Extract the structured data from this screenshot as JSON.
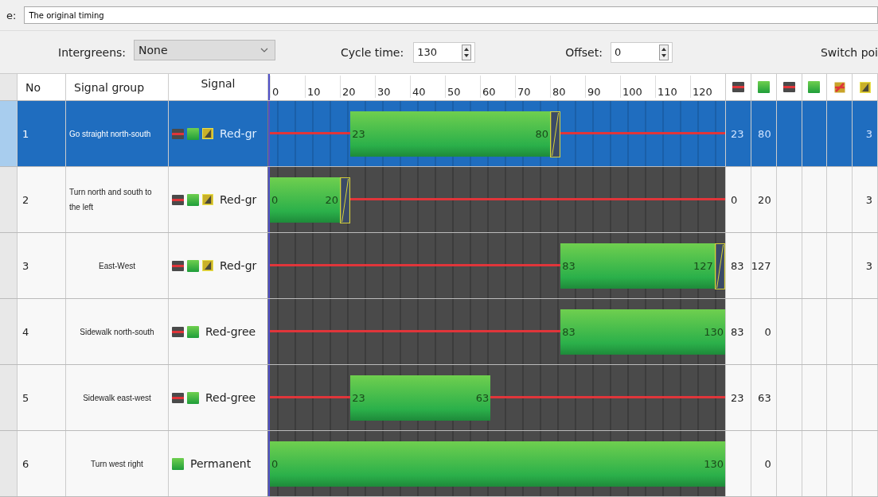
{
  "name_field": {
    "label": "e:",
    "value": "The original timing"
  },
  "toolbar": {
    "intergreens_label": "Intergreens:",
    "intergreens_value": "None",
    "cycle_label": "Cycle time:",
    "cycle_value": "130",
    "offset_label": "Offset:",
    "offset_value": "0",
    "switch_label": "Switch poi"
  },
  "table": {
    "columns": {
      "no": "No",
      "group": "Signal group",
      "signal": "Signal"
    },
    "ticks": [
      "0",
      "10",
      "20",
      "30",
      "40",
      "50",
      "60",
      "70",
      "80",
      "90",
      "100",
      "110",
      "120"
    ],
    "state_columns": [
      {
        "kind": "stop"
      },
      {
        "kind": "go"
      },
      {
        "kind": "stop"
      },
      {
        "kind": "go"
      },
      {
        "kind": "crossed"
      },
      {
        "kind": "amber"
      }
    ],
    "rows": [
      {
        "no": "1",
        "group": "Go straight north-south",
        "signals": [
          {
            "kind": "stop"
          },
          {
            "kind": "go"
          },
          {
            "kind": "amber"
          }
        ],
        "signal_text": "Red-gr",
        "selected": true,
        "kind": "red-green",
        "green_start": "23",
        "green_end": "80",
        "col_1": "23",
        "col_2": "80",
        "col_6": "3"
      },
      {
        "no": "2",
        "group": "Turn north and south to the left",
        "signals": [
          {
            "kind": "stop"
          },
          {
            "kind": "go"
          },
          {
            "kind": "amber"
          }
        ],
        "signal_text": "Red-gr",
        "selected": false,
        "kind": "red-green",
        "green_start": "0",
        "green_end": "20",
        "col_1": "0",
        "col_2": "20",
        "col_6": "3"
      },
      {
        "no": "3",
        "group": "East-West",
        "signals": [
          {
            "kind": "stop"
          },
          {
            "kind": "go"
          },
          {
            "kind": "amber"
          }
        ],
        "signal_text": "Red-gr",
        "selected": false,
        "kind": "red-green",
        "green_start": "83",
        "green_end": "127",
        "col_1": "83",
        "col_2": "127",
        "col_6": "3"
      },
      {
        "no": "4",
        "group": "Sidewalk north-south",
        "signals": [
          {
            "kind": "stop"
          },
          {
            "kind": "go"
          }
        ],
        "signal_text": "Red-gree",
        "selected": false,
        "kind": "red-green",
        "green_start": "83",
        "green_end": "130",
        "col_1": "83",
        "col_2": "0"
      },
      {
        "no": "5",
        "group": "Sidewalk east-west",
        "signals": [
          {
            "kind": "stop"
          },
          {
            "kind": "go"
          }
        ],
        "signal_text": "Red-gree",
        "selected": false,
        "kind": "red-green",
        "green_start": "23",
        "green_end": "63",
        "col_1": "23",
        "col_2": "63"
      },
      {
        "no": "6",
        "group": "Turn west right",
        "signals": [
          {
            "kind": "go"
          }
        ],
        "signal_text": "Permanent",
        "selected": false,
        "kind": "permanent",
        "green_start": "0",
        "green_end": "130",
        "col_2": "0"
      }
    ]
  }
}
